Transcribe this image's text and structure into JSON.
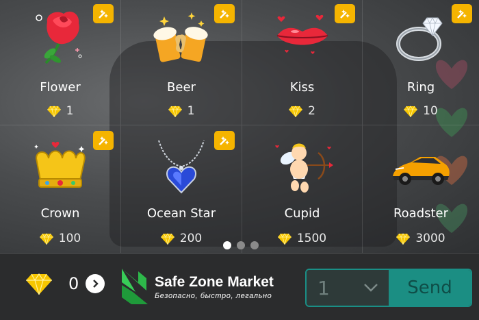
{
  "gifts": [
    {
      "name": "Flower",
      "price": "1",
      "icon": "rose-icon"
    },
    {
      "name": "Beer",
      "price": "1",
      "icon": "beer-mugs-icon"
    },
    {
      "name": "Kiss",
      "price": "2",
      "icon": "lips-icon"
    },
    {
      "name": "Ring",
      "price": "10",
      "icon": "diamond-ring-icon"
    },
    {
      "name": "Crown",
      "price": "100",
      "icon": "crown-icon"
    },
    {
      "name": "Ocean Star",
      "price": "200",
      "icon": "heart-necklace-icon"
    },
    {
      "name": "Cupid",
      "price": "1500",
      "icon": "cupid-icon"
    },
    {
      "name": "Roadster",
      "price": "3000",
      "icon": "sports-car-icon"
    }
  ],
  "badge_icon": "wand-sparkle-icon",
  "price_icon": "diamond-icon",
  "pager": {
    "count": 3,
    "active": 1
  },
  "balance": {
    "value": "0",
    "icon": "diamond-icon",
    "action_icon": "chevron-right-icon"
  },
  "watermark": {
    "title": "Safe Zone Market",
    "subtitle": "Безопасно, быстро, легально"
  },
  "quantity": {
    "value": "1",
    "icon": "chevron-down-icon"
  },
  "send": {
    "label": "Send"
  },
  "colors": {
    "accent": "#1b8e83",
    "badge": "#f5b400",
    "gem": "#f7c600",
    "bar": "#2b2c2d"
  }
}
